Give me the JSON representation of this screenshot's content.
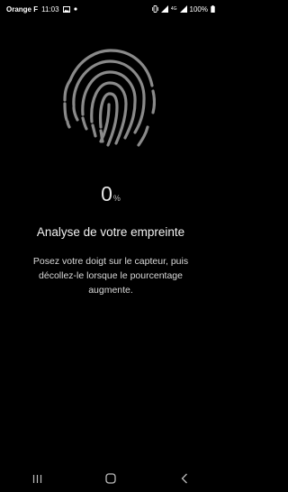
{
  "status_bar": {
    "carrier": "Orange F",
    "time": "11:03",
    "network_type": "4G",
    "battery_percent": "100%",
    "icons": [
      "gallery-icon",
      "dot-icon",
      "vibrate-icon",
      "signal-icon",
      "signal-icon",
      "battery-icon"
    ]
  },
  "enrollment": {
    "progress_value": "0",
    "progress_unit": "%",
    "title": "Analyse de votre empreinte",
    "instructions": "Posez votre doigt sur le capteur, puis décollez-le lorsque le pourcentage augmente."
  },
  "navigation": {
    "icons": [
      "recent-apps-icon",
      "home-icon",
      "back-icon"
    ]
  },
  "colors": {
    "background": "#000000",
    "fingerprint": "#8a8a8a",
    "text": "#ffffff"
  }
}
